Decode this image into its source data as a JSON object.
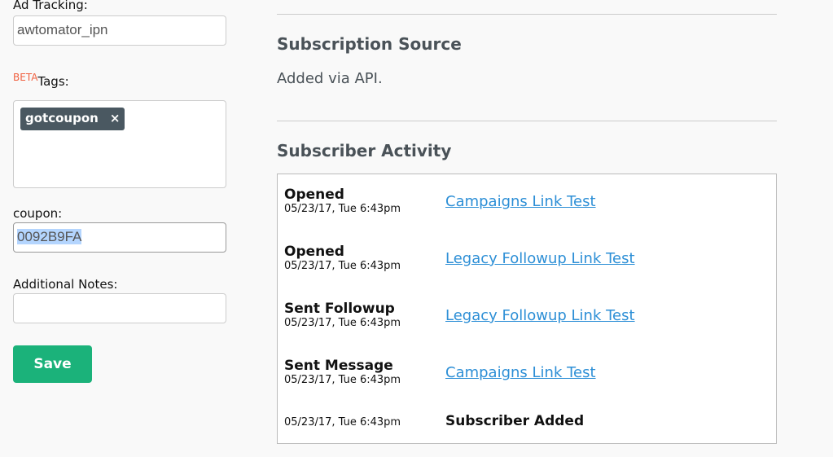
{
  "form": {
    "ad_tracking_label": "Ad Tracking:",
    "ad_tracking_value": "awtomator_ipn",
    "beta_badge": "BETA",
    "tags_label": "Tags:",
    "tags": [
      {
        "label": "gotcoupon",
        "remove": "×"
      }
    ],
    "coupon_label": "coupon:",
    "coupon_value": "0092B9FA",
    "notes_label": "Additional Notes:",
    "notes_value": "",
    "save_label": "Save"
  },
  "source": {
    "title": "Subscription Source",
    "text": "Added via API."
  },
  "activity": {
    "title": "Subscriber Activity",
    "rows": [
      {
        "action": "Opened",
        "date": "05/23/17, Tue 6:43pm",
        "target": "Campaigns Link Test"
      },
      {
        "action": "Opened",
        "date": "05/23/17, Tue 6:43pm",
        "target": "Legacy Followup Link Test"
      },
      {
        "action": "Sent Followup",
        "date": "05/23/17, Tue 6:43pm",
        "target": "Legacy Followup Link Test"
      },
      {
        "action": "Sent Message",
        "date": "05/23/17, Tue 6:43pm",
        "target": "Campaigns Link Test"
      },
      {
        "action": "",
        "date": "05/23/17, Tue 6:43pm",
        "target": "Subscriber Added"
      }
    ]
  },
  "colors": {
    "accent": "#1bb27a",
    "link": "#2d8fd6",
    "tag": "#4a5861",
    "beta": "#f06040"
  }
}
